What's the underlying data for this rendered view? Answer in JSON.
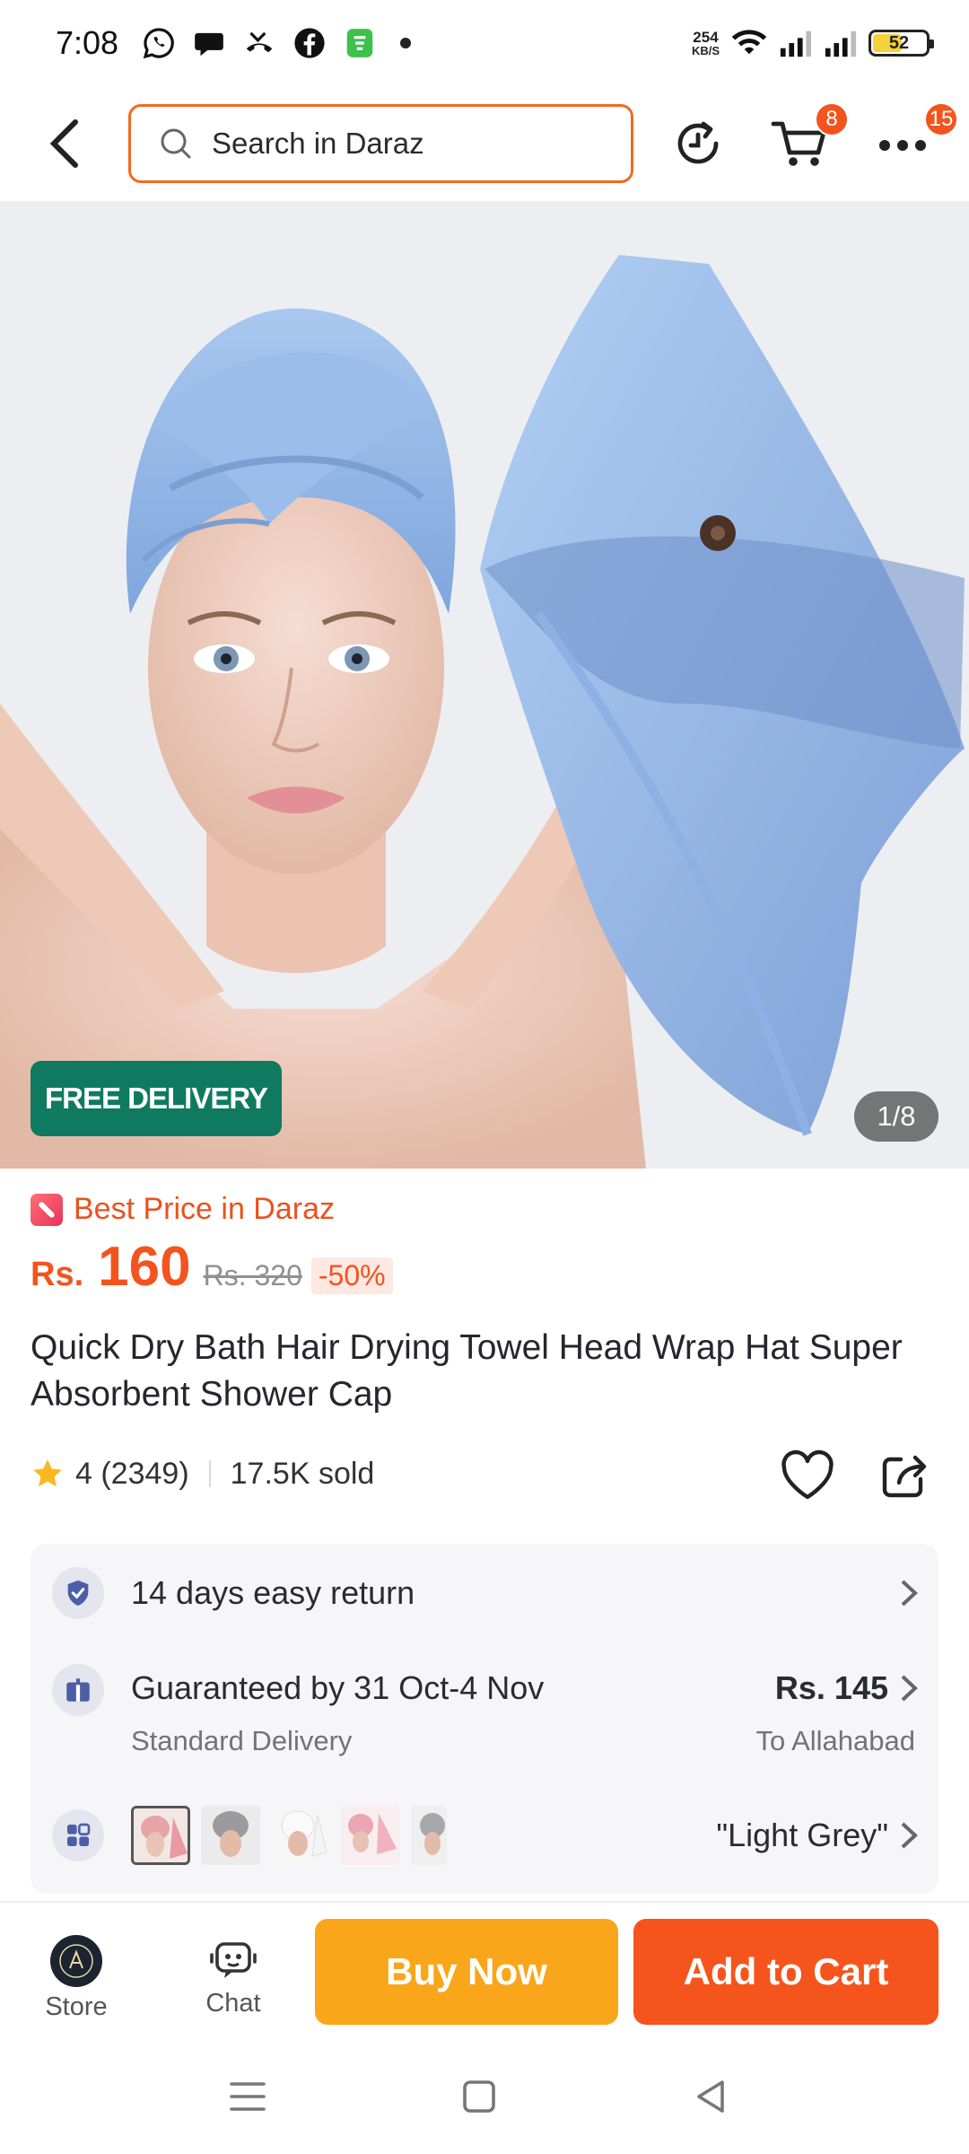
{
  "status_bar": {
    "time": "7:08",
    "net_speed_value": "254",
    "net_speed_unit": "KB/S",
    "battery": "52",
    "notification_icons": [
      "whatsapp-icon",
      "chat-bubble-icon",
      "missed-call-icon",
      "facebook-icon",
      "app-icon"
    ]
  },
  "header": {
    "search_placeholder": "Search in Daraz",
    "cart_badge": "8",
    "more_badge": "15",
    "accent_color": "#f36a20"
  },
  "hero": {
    "free_delivery_label": "FREE DELIVERY",
    "image_counter": "1/8"
  },
  "product": {
    "best_price_label": "Best Price in Daraz",
    "currency": "Rs.",
    "price": "160",
    "original_price": "Rs. 320",
    "discount": "-50%",
    "title": "Quick Dry Bath Hair Drying Towel Head Wrap Hat Super Absorbent Shower Cap",
    "rating": "4 (2349)",
    "sold": "17.5K sold"
  },
  "info": {
    "return_policy": "14 days easy return",
    "delivery_guarantee": "Guaranteed by 31 Oct-4 Nov",
    "delivery_type": "Standard Delivery",
    "delivery_fee": "Rs. 145",
    "delivery_destination": "To Allahabad",
    "selected_variant": "\"Light Grey\"",
    "variant_count_shown": 5
  },
  "bottom_bar": {
    "store_label": "Store",
    "chat_label": "Chat",
    "buy_now_label": "Buy Now",
    "add_to_cart_label": "Add to Cart",
    "buy_now_color": "#faa61a",
    "add_to_cart_color": "#f5541d"
  }
}
